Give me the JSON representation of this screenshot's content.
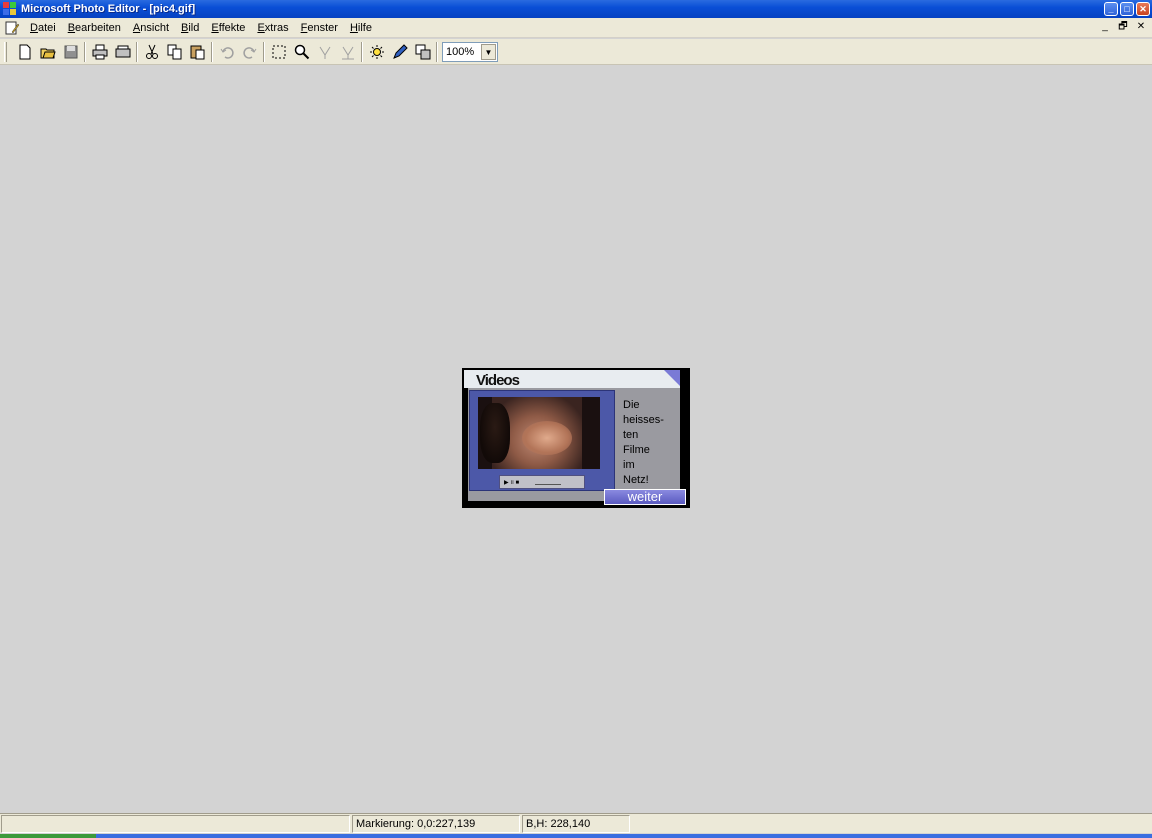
{
  "window": {
    "title": "Microsoft Photo Editor - [pic4.gif]",
    "buttons": {
      "minimize": "_",
      "maximize": "□",
      "close": "✕"
    }
  },
  "menu": {
    "items": [
      "Datei",
      "Bearbeiten",
      "Ansicht",
      "Bild",
      "Effekte",
      "Extras",
      "Fenster",
      "Hilfe"
    ],
    "mdi": {
      "minimize": "_",
      "restore": "🗗",
      "close": "✕"
    }
  },
  "toolbar": {
    "zoom": "100%",
    "icons": [
      "new-icon",
      "open-icon",
      "save-icon",
      "print-icon",
      "scan-icon",
      "cut-icon",
      "copy-icon",
      "paste-icon",
      "undo-icon",
      "redo-icon",
      "select-icon",
      "zoom-icon",
      "smudge-icon",
      "sharpen-icon",
      "balance-icon",
      "edit-icon",
      "replace-color-icon"
    ]
  },
  "image": {
    "header": "Videos",
    "text": "Die\nheisses-\nten\nFilme\nim\nNetz!",
    "button": "weiter",
    "player": "▶ ॥ ■"
  },
  "status": {
    "selection": "Markierung: 0,0:227,139",
    "size": "B,H: 228,140"
  }
}
